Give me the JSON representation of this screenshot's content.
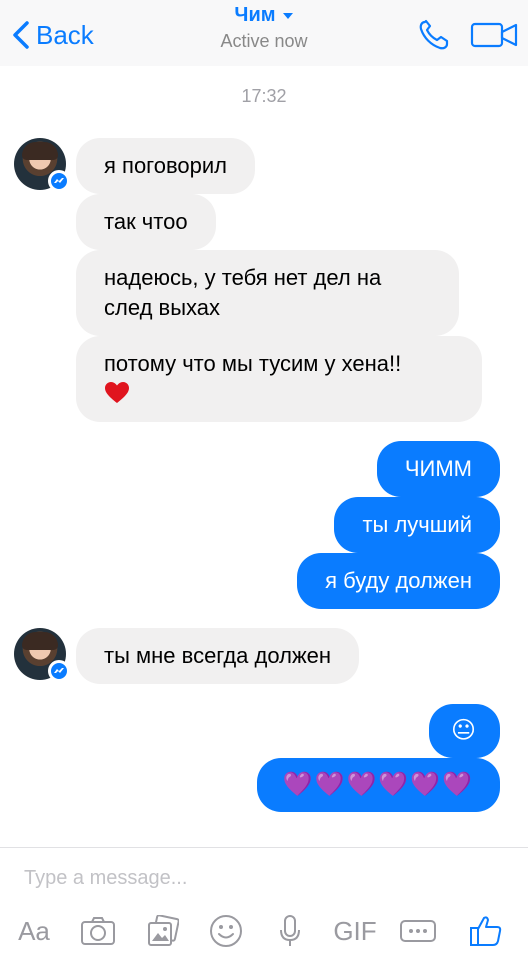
{
  "header": {
    "back_label": "Back",
    "contact_name": "Чим",
    "status": "Active now",
    "accent_color": "#0a7cff"
  },
  "timestamp": "17:32",
  "messages": [
    {
      "side": "incoming",
      "text": "я поговорил"
    },
    {
      "side": "incoming",
      "text": "так чтоо"
    },
    {
      "side": "incoming",
      "text": "надеюсь, у тебя нет дел на след выхах"
    },
    {
      "side": "incoming",
      "text": "потому что мы тусим у хена!!",
      "emoji": "red-heart"
    },
    {
      "side": "outgoing",
      "text": "ЧИММ"
    },
    {
      "side": "outgoing",
      "text": "ты лучший"
    },
    {
      "side": "outgoing",
      "text": "я буду должен"
    },
    {
      "side": "incoming",
      "text": "ты мне всегда должен"
    },
    {
      "side": "outgoing",
      "text": "😐"
    },
    {
      "side": "outgoing",
      "text": "💜💜💜💜💜💜"
    }
  ],
  "composer": {
    "placeholder": "Type a message...",
    "aa_label": "Aa",
    "gif_label": "GIF"
  },
  "icons": [
    "chevron-left-icon",
    "chevron-down-icon",
    "phone-icon",
    "video-camera-icon",
    "messenger-badge-icon",
    "camera-icon",
    "photo-gallery-icon",
    "smiley-icon",
    "microphone-icon",
    "more-icon",
    "thumbs-up-icon"
  ]
}
